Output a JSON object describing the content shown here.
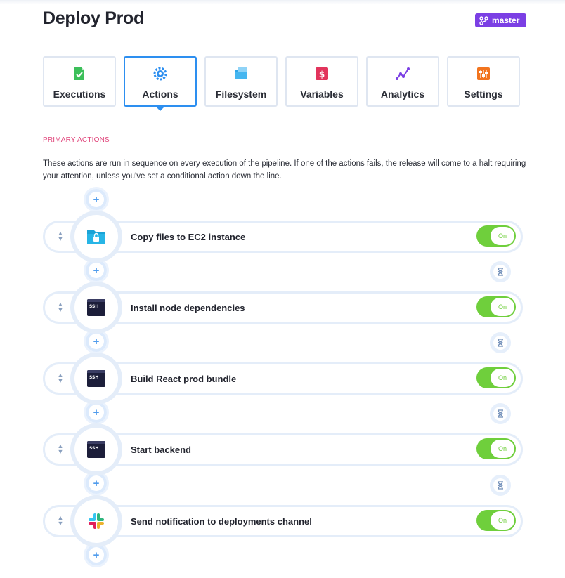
{
  "page": {
    "title": "Deploy Prod",
    "branch": "master"
  },
  "tabs": [
    {
      "label": "Executions",
      "icon": "executions-icon",
      "active": false
    },
    {
      "label": "Actions",
      "icon": "gear-icon",
      "active": true
    },
    {
      "label": "Filesystem",
      "icon": "filesystem-icon",
      "active": false
    },
    {
      "label": "Variables",
      "icon": "variables-icon",
      "active": false
    },
    {
      "label": "Analytics",
      "icon": "analytics-icon",
      "active": false
    },
    {
      "label": "Settings",
      "icon": "settings-sliders-icon",
      "active": false
    }
  ],
  "section": {
    "title": "PRIMARY ACTIONS",
    "description": "These actions are run in sequence on every execution of the pipeline. If one of the actions fails, the release will come to a halt requiring your attention, unless you've set a conditional action down the line."
  },
  "actions": [
    {
      "name": "Copy files to EC2 instance",
      "icon": "sftp-folder-icon",
      "toggle": "On"
    },
    {
      "name": "Install node dependencies",
      "icon": "ssh-terminal-icon",
      "toggle": "On"
    },
    {
      "name": "Build React prod bundle",
      "icon": "ssh-terminal-icon",
      "toggle": "On"
    },
    {
      "name": "Start backend",
      "icon": "ssh-terminal-icon",
      "toggle": "On"
    },
    {
      "name": "Send notification to deployments channel",
      "icon": "slack-icon",
      "toggle": "On"
    }
  ],
  "add_action_symbol": "+",
  "colors": {
    "accent": "#2d8ff0",
    "branch": "#7b3fe4",
    "section_title": "#e0457b",
    "toggle_on": "#6fcf3c"
  }
}
